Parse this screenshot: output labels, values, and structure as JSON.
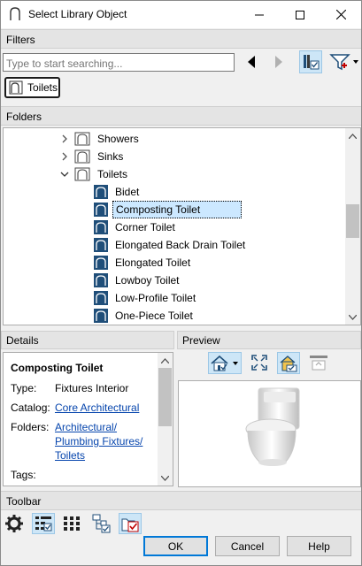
{
  "window": {
    "title": "Select Library Object"
  },
  "filters": {
    "header": "Filters",
    "search_placeholder": "Type to start searching...",
    "chip_label": "Toilets"
  },
  "folders": {
    "header": "Folders",
    "tree": [
      {
        "label": "Showers",
        "expanded": false,
        "type": "folder"
      },
      {
        "label": "Sinks",
        "expanded": false,
        "type": "folder"
      },
      {
        "label": "Toilets",
        "expanded": true,
        "type": "folder"
      },
      {
        "label": "Bidet",
        "type": "object"
      },
      {
        "label": "Composting Toilet",
        "type": "object",
        "selected": true
      },
      {
        "label": "Corner Toilet",
        "type": "object"
      },
      {
        "label": "Elongated Back Drain Toilet",
        "type": "object"
      },
      {
        "label": "Elongated Toilet",
        "type": "object"
      },
      {
        "label": "Lowboy Toilet",
        "type": "object"
      },
      {
        "label": "Low-Profile Toilet",
        "type": "object"
      },
      {
        "label": "One-Piece Toilet",
        "type": "object"
      }
    ]
  },
  "details": {
    "header": "Details",
    "title": "Composting Toilet",
    "type_key": "Type:",
    "type_value": "Fixtures Interior",
    "catalog_key": "Catalog:",
    "catalog_value": "Core Architectural",
    "folders_key": "Folders:",
    "folders_line1": "Architectural/",
    "folders_line2": "Plumbing Fixtures/",
    "folders_line3": "Toilets",
    "tags_key": "Tags:"
  },
  "preview": {
    "header": "Preview"
  },
  "toolbar": {
    "header": "Toolbar"
  },
  "buttons": {
    "ok": "OK",
    "cancel": "Cancel",
    "help": "Help"
  },
  "colors": {
    "accent": "#0078d7",
    "selection": "#cce8ff",
    "link": "#0645ad",
    "icon_blue": "#1f4e79"
  }
}
